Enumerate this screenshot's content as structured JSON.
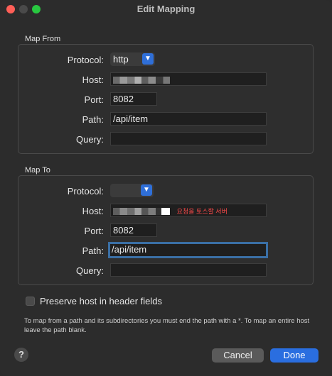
{
  "window": {
    "title": "Edit Mapping"
  },
  "map_from": {
    "section_label": "Map From",
    "protocol_label": "Protocol:",
    "protocol_value": "http",
    "host_label": "Host:",
    "port_label": "Port:",
    "port_value": "8082",
    "path_label": "Path:",
    "path_value": "/api/item",
    "query_label": "Query:",
    "query_value": ""
  },
  "map_to": {
    "section_label": "Map To",
    "protocol_label": "Protocol:",
    "protocol_value": "",
    "host_label": "Host:",
    "host_note": "요청을 토스할 서버",
    "port_label": "Port:",
    "port_value": "8082",
    "path_label": "Path:",
    "path_value": "/api/item",
    "query_label": "Query:",
    "query_value": ""
  },
  "options": {
    "preserve_host_label": "Preserve host in header fields",
    "preserve_host_checked": false
  },
  "help_text": "To map from a path and its subdirectories you must end the path with a *. To map an entire host leave the path blank.",
  "buttons": {
    "help": "?",
    "cancel": "Cancel",
    "done": "Done"
  },
  "colors": {
    "accent": "#2a6ee0",
    "note_red": "#ff4a4a",
    "close": "#ff5f57",
    "maximize": "#28c840"
  }
}
